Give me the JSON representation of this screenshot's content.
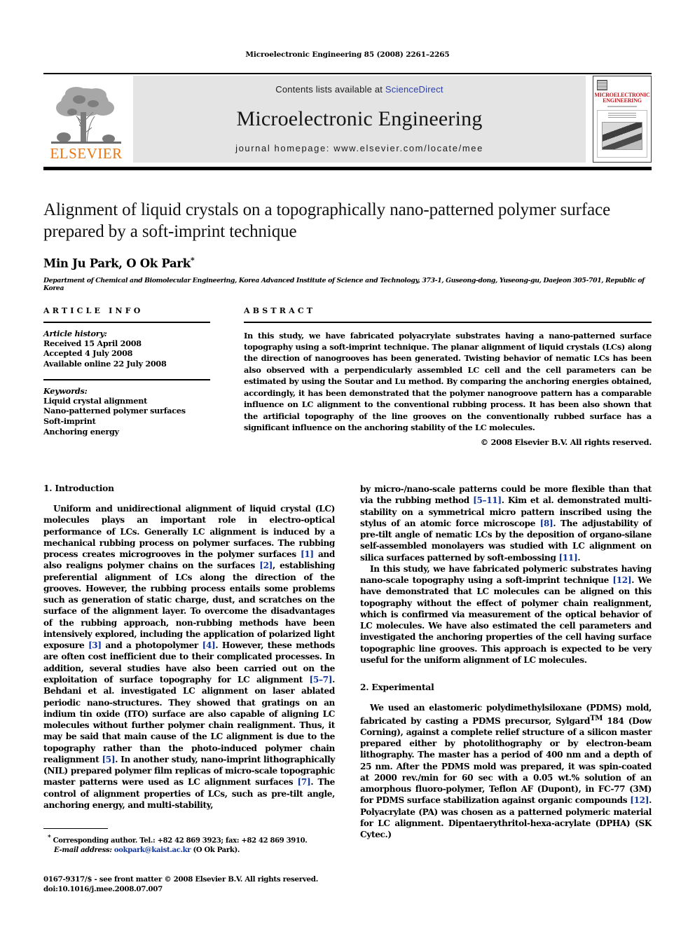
{
  "running_head": "Microelectronic Engineering 85 (2008) 2261–2265",
  "header": {
    "contents_prefix": "Contents lists available at ",
    "sciencedirect": "ScienceDirect",
    "journal_name": "Microelectronic Engineering",
    "homepage": "journal homepage: www.elsevier.com/locate/mee",
    "publisher": "ELSEVIER",
    "cover_title": "MICROELECTRONIC ENGINEERING",
    "colors": {
      "elsevier_orange": "#E87511",
      "sciencedirect_blue": "#2b3fb0",
      "cover_red": "#c0181f",
      "band_gray": "#e4e4e4",
      "link_blue": "#12359b"
    }
  },
  "title_block": {
    "title": "Alignment of liquid crystals on a topographically nano-patterned polymer surface prepared by a soft-imprint technique",
    "authors": "Min Ju Park, O Ok Park",
    "corresponding_marker": "*",
    "affiliation": "Department of Chemical and Biomolecular Engineering, Korea Advanced Institute of Science and Technology, 373-1, Guseong-dong, Yuseong-gu, Daejeon 305-701, Republic of Korea"
  },
  "article_info": {
    "label": "ARTICLE INFO",
    "history_head": "Article history:",
    "history": [
      "Received 15 April 2008",
      "Accepted 4 July 2008",
      "Available online 22 July 2008"
    ],
    "keywords_head": "Keywords:",
    "keywords": [
      "Liquid crystal alignment",
      "Nano-patterned polymer surfaces",
      "Soft-imprint",
      "Anchoring energy"
    ]
  },
  "abstract": {
    "label": "ABSTRACT",
    "text": "In this study, we have fabricated polyacrylate substrates having a nano-patterned surface topography using a soft-imprint technique. The planar alignment of liquid crystals (LCs) along the direction of nanogrooves has been generated. Twisting behavior of nematic LCs has been also observed with a perpendicularly assembled LC cell and the cell parameters can be estimated by using the Soutar and Lu method. By comparing the anchoring energies obtained, accordingly, it has been demonstrated that the polymer nanogroove pattern has a comparable influence on LC alignment to the conventional rubbing process. It has been also shown that the artificial topography of the line grooves on the conventionally rubbed surface has a significant influence on the anchoring stability of the LC molecules.",
    "copyright": "© 2008 Elsevier B.V. All rights reserved."
  },
  "body": {
    "section1_head": "1. Introduction",
    "section2_head": "2. Experimental",
    "left_para1_a": "Uniform and unidirectional alignment of liquid crystal (LC) molecules plays an important role in electro-optical performance of LCs. Generally LC alignment is induced by a mechanical rubbing process on polymer surfaces. The rubbing process creates microgrooves in the polymer surfaces ",
    "ref1": "[1]",
    "left_para1_b": " and also realigns polymer chains on the surfaces ",
    "ref2": "[2]",
    "left_para1_c": ", establishing preferential alignment of LCs along the direction of the grooves. However, the rubbing process entails some problems such as generation of static charge, dust, and scratches on the surface of the alignment layer. To overcome the disadvantages of the rubbing approach, non-rubbing methods have been intensively explored, including the application of polarized light exposure ",
    "ref3": "[3]",
    "left_para1_d": " and a photopolymer ",
    "ref4": "[4]",
    "left_para1_e": ". However, these methods are often cost inefficient due to their complicated processes. In addition, several studies have also been carried out on the exploitation of surface topography for LC alignment ",
    "ref5_7": "[5–7]",
    "left_para1_f": ". Behdani et al. investigated LC alignment on laser ablated periodic nano-structures. They showed that gratings on an indium tin oxide (ITO) surface are also capable of aligning LC molecules without further polymer chain realignment. Thus, it may be said that main cause of the LC alignment is due to the topography rather than the photo-induced polymer chain realignment ",
    "ref5": "[5]",
    "left_para1_g": ". In another study, nano-imprint lithographically (NIL) prepared polymer film replicas of micro-scale topographic master patterns were used as LC alignment surfaces ",
    "ref7": "[7]",
    "left_para1_h": ". The control of alignment properties of LCs, such as pre-tilt angle, anchoring energy, and multi-stability,",
    "right_para1_a": "by micro-/nano-scale patterns could be more flexible than that via the rubbing method ",
    "ref5_11": "[5–11]",
    "right_para1_b": ". Kim et al. demonstrated multi-stability on a symmetrical micro pattern inscribed using the stylus of an atomic force microscope ",
    "ref8": "[8]",
    "right_para1_c": ". The adjustability of pre-tilt angle of nematic LCs by the deposition of organo-silane self-assembled monolayers was studied with LC alignment on silica surfaces patterned by soft-embossing ",
    "ref11": "[11]",
    "right_para1_d": ".",
    "right_para2_a": "In this study, we have fabricated polymeric substrates having nano-scale topography using a soft-imprint technique ",
    "ref12": "[12]",
    "right_para2_b": ". We have demonstrated that LC molecules can be aligned on this topography without the effect of polymer chain realignment, which is confirmed via measurement of the optical behavior of LC molecules. We have also estimated the cell parameters and investigated the anchoring properties of the cell having surface topographic line grooves. This approach is expected to be very useful for the uniform alignment of LC molecules.",
    "right_para3_a": "We used an elastomeric polydimethylsiloxane (PDMS) mold, fabricated by casting a PDMS precursor, Sylgard",
    "tm": "TM",
    "right_para3_b": " 184 (Dow Corning), against a complete relief structure of a silicon master prepared either by photolithography or by electron-beam lithography. The master has a period of 400 nm and a depth of 25 nm. After the PDMS mold was prepared, it was spin-coated at 2000 rev./min for 60 sec with a 0.05 wt.% solution of an amorphous fluoro-polymer, Teflon AF (Dupont), in FC-77 (3M) for PDMS surface stabilization against organic compounds ",
    "ref12b": "[12]",
    "right_para3_c": ". Polyacrylate (PA) was chosen as a patterned polymeric material for LC alignment. Dipentaerythritol-hexa-acrylate (DPHA) (SK Cytec.)"
  },
  "footnote": {
    "bullet": "*",
    "corresponding": "Corresponding author. Tel.: +82 42 869 3923; fax: +82 42 869 3910.",
    "email_label": "E-mail address:",
    "email": "ookpark@kaist.ac.kr",
    "email_owner": "(O Ok Park).",
    "imprint_line1": "0167-9317/$ - see front matter © 2008 Elsevier B.V. All rights reserved.",
    "imprint_line2": "doi:10.1016/j.mee.2008.07.007"
  }
}
